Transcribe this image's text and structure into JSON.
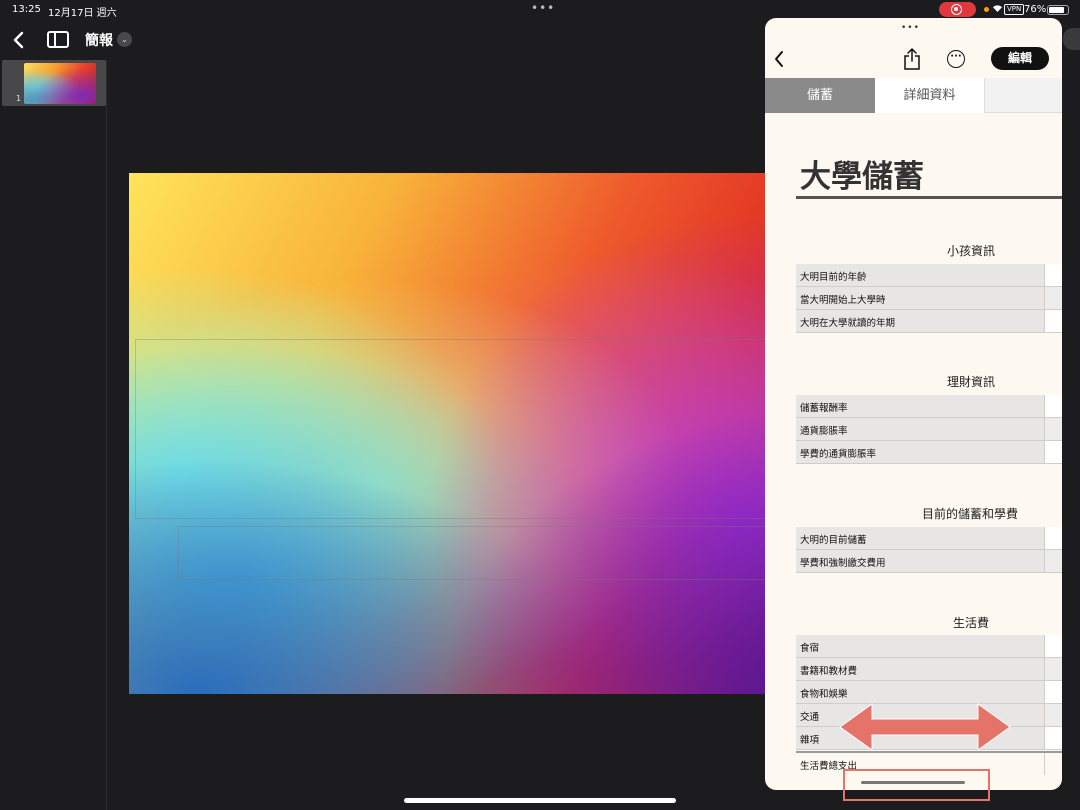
{
  "status_bar": {
    "time": "13:25",
    "date": "12月17日 週六",
    "multitask_dots": "•••",
    "vpn": "VPN",
    "battery": "76%"
  },
  "toolbar": {
    "back_icon": "chevron-left-icon",
    "sidebar_icon": "sidebar-icon",
    "title": "簡報",
    "title_chevron": "⌄"
  },
  "navigator": {
    "slides": [
      {
        "number": "1"
      }
    ]
  },
  "slide_over": {
    "grabber": "•••",
    "edit_label": "編輯",
    "more_label": "···",
    "tabs": [
      {
        "label": "儲蓄",
        "active": true
      },
      {
        "label": "詳細資料",
        "active": false
      }
    ],
    "sheet_title": "大學儲蓄",
    "sections": [
      {
        "title": "小孩資訊",
        "rows": [
          "大明目前的年齡",
          "當大明開始上大學時",
          "大明在大學就讀的年期"
        ]
      },
      {
        "title": "理財資訊",
        "rows": [
          "儲蓄報酬率",
          "通貨膨脹率",
          "學費的通貨膨脹率"
        ]
      },
      {
        "title": "目前的儲蓄和學費",
        "rows": [
          "大明的目前儲蓄",
          "學費和強制繳交費用"
        ]
      },
      {
        "title": "生活費",
        "rows": [
          "食宿",
          "書籍和教材費",
          "食物和娛樂",
          "交通",
          "雜項"
        ],
        "total": "生活費總支出"
      }
    ]
  },
  "colors": {
    "accent_annotation": "#e5736a",
    "edit_button": "#111111",
    "active_tab": "#8a8a8a"
  }
}
